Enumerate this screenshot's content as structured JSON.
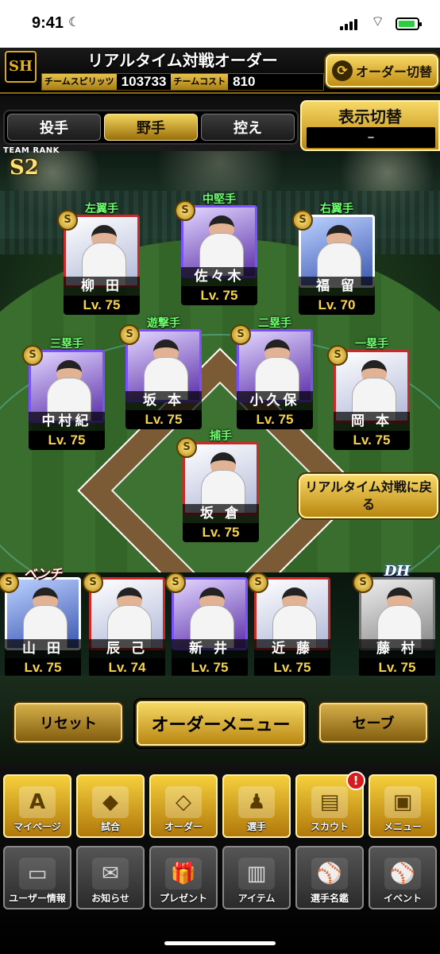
{
  "status_bar": {
    "time": "9:41"
  },
  "header": {
    "logo_text": "SH",
    "title": "リアルタイム対戦オーダー",
    "team_spirits_label": "チームスピリッツ",
    "team_spirits_value": "103733",
    "team_cost_label": "チームコスト",
    "team_cost_value": "810",
    "order_switch_label": "オーダー切替"
  },
  "tabs": [
    {
      "label": "投手",
      "active": false
    },
    {
      "label": "野手",
      "active": true
    },
    {
      "label": "控え",
      "active": false
    }
  ],
  "display_switch": {
    "label": "表示切替",
    "value": "–"
  },
  "team_rank": {
    "label": "TEAM RANK",
    "value": "S2"
  },
  "lineup": [
    {
      "position": "左翼手",
      "name": "柳 田",
      "level": "Lv. 75"
    },
    {
      "position": "中堅手",
      "name": "佐々木",
      "level": "Lv. 75"
    },
    {
      "position": "右翼手",
      "name": "福 留",
      "level": "Lv. 70"
    },
    {
      "position": "三塁手",
      "name": "中村紀",
      "level": "Lv. 75"
    },
    {
      "position": "遊撃手",
      "name": "坂 本",
      "level": "Lv. 75"
    },
    {
      "position": "二塁手",
      "name": "小久保",
      "level": "Lv. 75"
    },
    {
      "position": "一塁手",
      "name": "岡 本",
      "level": "Lv. 75"
    },
    {
      "position": "捕手",
      "name": "坂 倉",
      "level": "Lv. 75"
    }
  ],
  "back_button": {
    "label": "リアルタイム対戦に戻る"
  },
  "bench_label": "ベンチ",
  "dh_label": "DH",
  "bench": [
    {
      "name": "山 田",
      "level": "Lv. 75"
    },
    {
      "name": "辰 己",
      "level": "Lv. 74"
    },
    {
      "name": "新 井",
      "level": "Lv. 75"
    },
    {
      "name": "近 藤",
      "level": "Lv. 75"
    }
  ],
  "dh": {
    "name": "藤 村",
    "level": "Lv. 75"
  },
  "controls": {
    "reset": "リセット",
    "order_menu": "オーダーメニュー",
    "save": "セーブ"
  },
  "nav_row1": [
    {
      "label": "マイページ",
      "icon": "A"
    },
    {
      "label": "試合",
      "icon": "◆"
    },
    {
      "label": "オーダー",
      "icon": "◇"
    },
    {
      "label": "選手",
      "icon": "♟"
    },
    {
      "label": "スカウト",
      "icon": "▤",
      "badge": "!"
    },
    {
      "label": "メニュー",
      "icon": "▣"
    }
  ],
  "nav_row2": [
    {
      "label": "ユーザー情報",
      "icon": "▭"
    },
    {
      "label": "お知らせ",
      "icon": "✉"
    },
    {
      "label": "プレゼント",
      "icon": "🎁"
    },
    {
      "label": "アイテム",
      "icon": "▥"
    },
    {
      "label": "選手名鑑",
      "icon": "⚾"
    },
    {
      "label": "イベント",
      "icon": "⚾"
    }
  ]
}
